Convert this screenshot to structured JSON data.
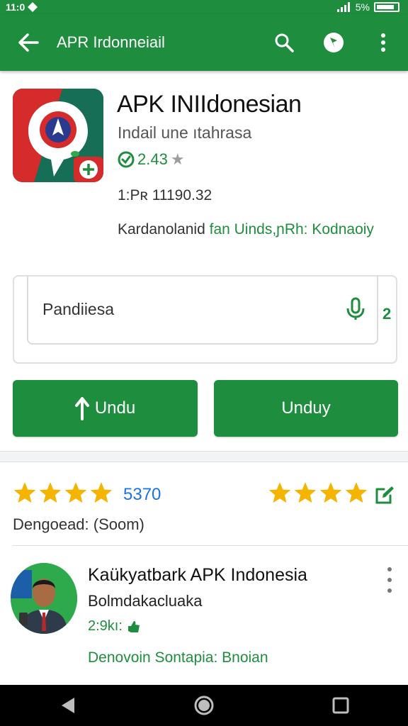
{
  "status_bar": {
    "time": "11:0",
    "battery_pct": "5%"
  },
  "app_bar": {
    "title": "APR Irdonneiail"
  },
  "app": {
    "name": "APK INIIdonesian",
    "subtitle": "Indail une ıtahrasa",
    "rating": "2.43",
    "meta": "1:Pʀ 11190.32",
    "developer_prefix": "Kardanolanid",
    "developer_link": "fan Uinds,ɲRh: Kodnaoiy"
  },
  "search": {
    "value": "Pandiiesa",
    "count": "2"
  },
  "buttons": {
    "primary": "Undu",
    "secondary": "Unduy"
  },
  "ratings": {
    "count": "5370",
    "downloads": "Dengoead: (Soom)"
  },
  "review": {
    "name": "Kaükyatbark APK Indonesia",
    "subtitle": "Bolmdakacluaka",
    "size": "2:9kı:",
    "link": "Denovoin Sontapia: Bnoian"
  },
  "colors": {
    "brand_green": "#1e8e3e",
    "star_gold": "#f4b400",
    "link_blue": "#1a73e8"
  },
  "icons": [
    "back-arrow-icon",
    "search-icon",
    "account-icon",
    "more-vert-icon",
    "mic-icon",
    "upload-arrow-icon",
    "star-icon",
    "edit-review-icon",
    "nav-back-icon",
    "nav-home-icon",
    "nav-recents-icon"
  ]
}
